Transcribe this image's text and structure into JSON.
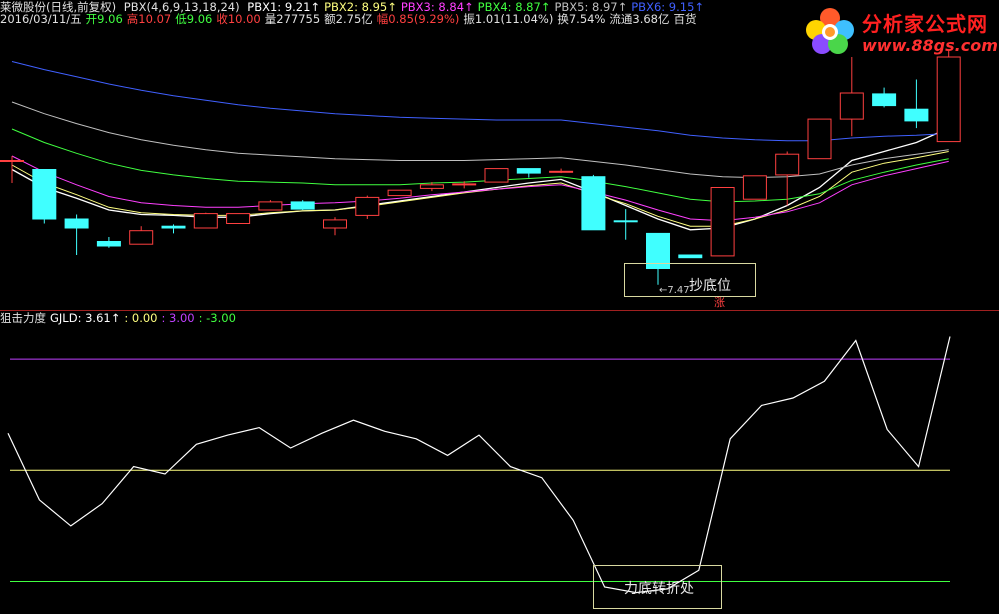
{
  "header": {
    "stock_title": "莱微股份(日线,前复权)",
    "indicator_name": "PBX(4,6,9,13,18,24)",
    "pbx_items": [
      {
        "label": "PBX1: 9.21↑",
        "color": "#ffffff"
      },
      {
        "label": "PBX2: 8.95↑",
        "color": "#ffff80"
      },
      {
        "label": "PBX3: 8.84↑",
        "color": "#ff40ff"
      },
      {
        "label": "PBX4: 8.87↑",
        "color": "#40ff40"
      },
      {
        "label": "PBX5: 8.97↑",
        "color": "#c0c0c0"
      },
      {
        "label": "PBX6: 9.15↑",
        "color": "#4060ff"
      }
    ],
    "quote_items": [
      {
        "label": "2016/03/11/五",
        "color": "#e0e0e0"
      },
      {
        "label": "开9.06",
        "color": "#40ff40"
      },
      {
        "label": "高10.07",
        "color": "#ff4040"
      },
      {
        "label": "低9.06",
        "color": "#40ff40"
      },
      {
        "label": "收10.00",
        "color": "#ff4040"
      },
      {
        "label": "量277755",
        "color": "#e0e0e0"
      },
      {
        "label": "额2.75亿",
        "color": "#e0e0e0"
      },
      {
        "label": "幅0.85(9.29%)",
        "color": "#ff4040"
      },
      {
        "label": "振1.01(11.04%)",
        "color": "#e0e0e0"
      },
      {
        "label": "换7.54%",
        "color": "#e0e0e0"
      },
      {
        "label": "流通3.68亿",
        "color": "#e0e0e0"
      },
      {
        "label": "百货",
        "color": "#e0e0e0"
      }
    ]
  },
  "logo": {
    "text": "分析家公式网",
    "url": "www.88gs.com"
  },
  "sub_header": {
    "items": [
      {
        "label": "狙击力度",
        "color": "#e0e0e0"
      },
      {
        "label": "GJLD: 3.61↑",
        "color": "#ffffff"
      },
      {
        "label": ": 0.00",
        "color": "#ffff80"
      },
      {
        "label": ": 3.00",
        "color": "#c040ff"
      },
      {
        "label": ": -3.00",
        "color": "#40ff40"
      }
    ]
  },
  "annotations": {
    "buy_label": "抄底位",
    "low_value": "←7.47",
    "zhang": "涨",
    "turn_label": "力底转折处"
  },
  "colors": {
    "up": "#ff4040",
    "down": "#40ffff",
    "ma1": "#ffffff",
    "ma2": "#ffff80",
    "ma3": "#ff40ff",
    "ma4": "#40ff40",
    "ma5": "#c0c0c0",
    "ma6": "#4060ff",
    "ref_high": "#c040ff",
    "ref_zero": "#ffff80",
    "ref_low": "#40ff40"
  },
  "chart_data": [
    {
      "type": "candlestick",
      "price_range": [
        7.3,
        10.3
      ],
      "candles": [
        {
          "o": 8.85,
          "h": 8.9,
          "l": 8.6,
          "c": 8.85
        },
        {
          "o": 8.75,
          "h": 8.75,
          "l": 8.15,
          "c": 8.2
        },
        {
          "o": 8.2,
          "h": 8.25,
          "l": 7.8,
          "c": 8.1
        },
        {
          "o": 7.95,
          "h": 8.0,
          "l": 7.88,
          "c": 7.9
        },
        {
          "o": 7.92,
          "h": 8.12,
          "l": 7.92,
          "c": 8.07
        },
        {
          "o": 8.12,
          "h": 8.14,
          "l": 8.04,
          "c": 8.1
        },
        {
          "o": 8.1,
          "h": 8.27,
          "l": 8.1,
          "c": 8.26
        },
        {
          "o": 8.15,
          "h": 8.26,
          "l": 8.15,
          "c": 8.26
        },
        {
          "o": 8.3,
          "h": 8.41,
          "l": 8.3,
          "c": 8.39
        },
        {
          "o": 8.39,
          "h": 8.41,
          "l": 8.3,
          "c": 8.31
        },
        {
          "o": 8.1,
          "h": 8.22,
          "l": 8.02,
          "c": 8.19
        },
        {
          "o": 8.24,
          "h": 8.46,
          "l": 8.2,
          "c": 8.44
        },
        {
          "o": 8.46,
          "h": 8.52,
          "l": 8.46,
          "c": 8.52
        },
        {
          "o": 8.54,
          "h": 8.61,
          "l": 8.51,
          "c": 8.58
        },
        {
          "o": 8.58,
          "h": 8.62,
          "l": 8.54,
          "c": 8.59
        },
        {
          "o": 8.61,
          "h": 8.76,
          "l": 8.61,
          "c": 8.76
        },
        {
          "o": 8.76,
          "h": 8.76,
          "l": 8.66,
          "c": 8.71
        },
        {
          "o": 8.73,
          "h": 8.76,
          "l": 8.71,
          "c": 8.73
        },
        {
          "o": 8.67,
          "h": 8.69,
          "l": 8.08,
          "c": 8.08
        },
        {
          "o": 8.18,
          "h": 8.31,
          "l": 7.97,
          "c": 8.17
        },
        {
          "o": 8.04,
          "h": 8.04,
          "l": 7.47,
          "c": 7.65
        },
        {
          "o": 7.8,
          "h": 7.8,
          "l": 7.77,
          "c": 7.77
        },
        {
          "o": 7.79,
          "h": 8.55,
          "l": 7.79,
          "c": 8.55
        },
        {
          "o": 8.42,
          "h": 8.68,
          "l": 8.42,
          "c": 8.68
        },
        {
          "o": 8.69,
          "h": 8.95,
          "l": 8.35,
          "c": 8.92
        },
        {
          "o": 8.87,
          "h": 9.31,
          "l": 8.87,
          "c": 9.31
        },
        {
          "o": 9.31,
          "h": 10.0,
          "l": 9.12,
          "c": 9.6
        },
        {
          "o": 9.59,
          "h": 9.66,
          "l": 9.44,
          "c": 9.46
        },
        {
          "o": 9.42,
          "h": 9.75,
          "l": 9.21,
          "c": 9.29
        },
        {
          "o": 9.06,
          "h": 10.07,
          "l": 9.06,
          "c": 10.0
        }
      ],
      "ma_series": [
        {
          "name": "PBX1",
          "values": [
            8.75,
            8.55,
            8.43,
            8.3,
            8.25,
            8.24,
            8.22,
            8.22,
            8.26,
            8.29,
            8.3,
            8.35,
            8.4,
            8.45,
            8.5,
            8.55,
            8.6,
            8.64,
            8.5,
            8.35,
            8.2,
            8.08,
            8.1,
            8.2,
            8.35,
            8.55,
            8.85,
            8.95,
            9.05,
            9.21
          ]
        },
        {
          "name": "PBX2",
          "values": [
            8.8,
            8.6,
            8.47,
            8.33,
            8.27,
            8.25,
            8.24,
            8.24,
            8.27,
            8.29,
            8.3,
            8.34,
            8.39,
            8.44,
            8.49,
            8.53,
            8.57,
            8.6,
            8.48,
            8.37,
            8.23,
            8.12,
            8.12,
            8.2,
            8.3,
            8.45,
            8.72,
            8.82,
            8.88,
            8.95
          ]
        },
        {
          "name": "PBX3",
          "values": [
            8.9,
            8.72,
            8.58,
            8.45,
            8.38,
            8.35,
            8.33,
            8.33,
            8.35,
            8.37,
            8.38,
            8.4,
            8.43,
            8.47,
            8.5,
            8.53,
            8.56,
            8.58,
            8.5,
            8.41,
            8.3,
            8.2,
            8.18,
            8.22,
            8.28,
            8.38,
            8.58,
            8.68,
            8.76,
            8.84
          ]
        },
        {
          "name": "PBX4",
          "values": [
            9.2,
            9.05,
            8.93,
            8.82,
            8.74,
            8.69,
            8.65,
            8.62,
            8.61,
            8.6,
            8.58,
            8.58,
            8.58,
            8.6,
            8.61,
            8.63,
            8.65,
            8.67,
            8.62,
            8.56,
            8.49,
            8.42,
            8.39,
            8.4,
            8.42,
            8.48,
            8.63,
            8.72,
            8.8,
            8.87
          ]
        },
        {
          "name": "PBX5",
          "values": [
            9.5,
            9.37,
            9.26,
            9.16,
            9.08,
            9.02,
            8.97,
            8.93,
            8.91,
            8.89,
            8.87,
            8.86,
            8.85,
            8.85,
            8.85,
            8.86,
            8.87,
            8.88,
            8.84,
            8.8,
            8.75,
            8.7,
            8.67,
            8.66,
            8.67,
            8.7,
            8.8,
            8.87,
            8.92,
            8.97
          ]
        },
        {
          "name": "PBX6",
          "values": [
            9.95,
            9.86,
            9.78,
            9.7,
            9.63,
            9.57,
            9.52,
            9.47,
            9.43,
            9.4,
            9.37,
            9.35,
            9.33,
            9.32,
            9.31,
            9.3,
            9.3,
            9.3,
            9.26,
            9.22,
            9.18,
            9.13,
            9.1,
            9.08,
            9.07,
            9.07,
            9.1,
            9.12,
            9.13,
            9.15
          ]
        }
      ]
    },
    {
      "type": "line",
      "name": "GJLD",
      "yrange": [
        -3.5,
        4.0
      ],
      "values": [
        1.0,
        -0.8,
        -1.5,
        -0.9,
        0.1,
        -0.1,
        0.7,
        0.95,
        1.15,
        0.6,
        1.0,
        1.35,
        1.05,
        0.85,
        0.4,
        0.95,
        0.1,
        -0.2,
        -1.35,
        -3.15,
        -3.3,
        -3.2,
        -2.7,
        0.85,
        1.75,
        1.95,
        2.4,
        3.5,
        1.1,
        0.1,
        3.61
      ],
      "ref_lines": [
        3.0,
        0.0,
        -3.0
      ]
    }
  ]
}
